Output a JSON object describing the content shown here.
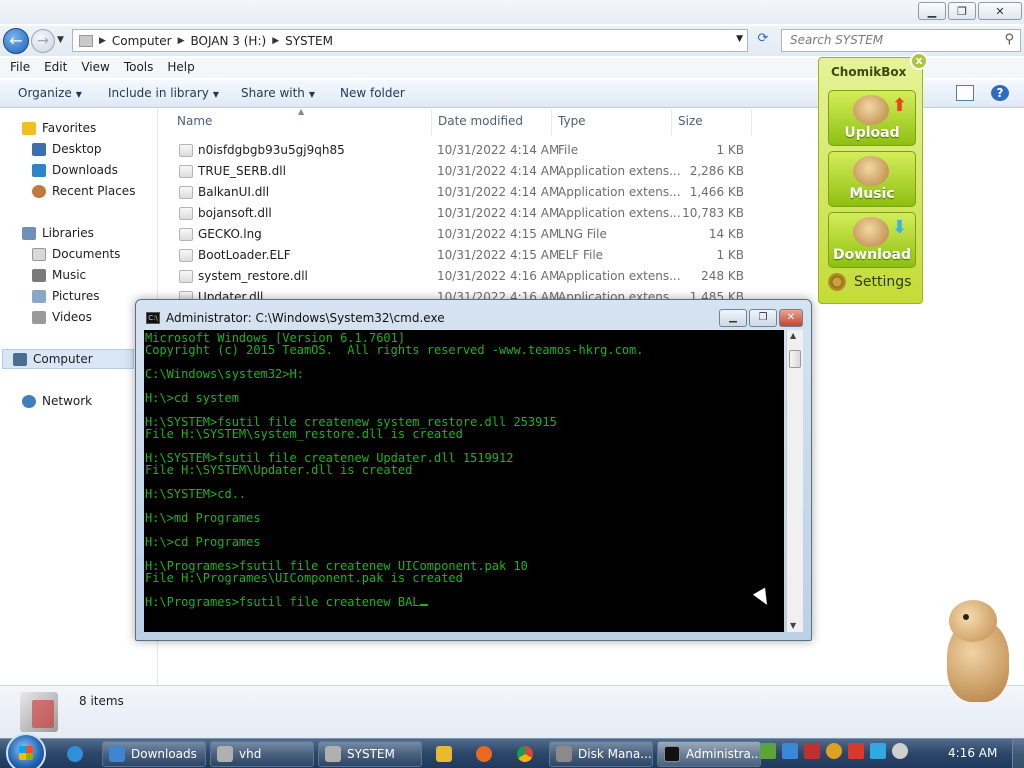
{
  "explorer": {
    "address": {
      "path": [
        "Computer",
        "BOJAN 3 (H:)",
        "SYSTEM"
      ]
    },
    "search_placeholder": "Search SYSTEM",
    "menu": [
      "File",
      "Edit",
      "View",
      "Tools",
      "Help"
    ],
    "commands": {
      "organize": "Organize",
      "include": "Include in library",
      "share": "Share with",
      "new_folder": "New folder"
    },
    "nav": {
      "favorites": "Favorites",
      "desktop": "Desktop",
      "downloads": "Downloads",
      "recent": "Recent Places",
      "libraries": "Libraries",
      "documents": "Documents",
      "music": "Music",
      "pictures": "Pictures",
      "videos": "Videos",
      "computer": "Computer",
      "network": "Network"
    },
    "columns": {
      "name": "Name",
      "date": "Date modified",
      "type": "Type",
      "size": "Size"
    },
    "files": [
      {
        "name": "n0isfdgbgb93u5gj9qh85",
        "date": "10/31/2022 4:14 AM",
        "type": "File",
        "size": "1 KB"
      },
      {
        "name": "TRUE_SERB.dll",
        "date": "10/31/2022 4:14 AM",
        "type": "Application extens...",
        "size": "2,286 KB"
      },
      {
        "name": "BalkanUI.dll",
        "date": "10/31/2022 4:14 AM",
        "type": "Application extens...",
        "size": "1,466 KB"
      },
      {
        "name": "bojansoft.dll",
        "date": "10/31/2022 4:14 AM",
        "type": "Application extens...",
        "size": "10,783 KB"
      },
      {
        "name": "GECKO.lng",
        "date": "10/31/2022 4:15 AM",
        "type": "LNG File",
        "size": "14 KB"
      },
      {
        "name": "BootLoader.ELF",
        "date": "10/31/2022 4:15 AM",
        "type": "ELF File",
        "size": "1 KB"
      },
      {
        "name": "system_restore.dll",
        "date": "10/31/2022 4:16 AM",
        "type": "Application extens...",
        "size": "248 KB"
      },
      {
        "name": "Updater.dll",
        "date": "10/31/2022 4:16 AM",
        "type": "Application extens...",
        "size": "1,485 KB"
      }
    ],
    "status": "8 items"
  },
  "chomikbox": {
    "title": "ChomikBox",
    "close": "x",
    "upload": "Upload",
    "music": "Music",
    "download": "Download",
    "settings": "Settings"
  },
  "cmd": {
    "title": "Administrator: C:\\Windows\\System32\\cmd.exe",
    "lines": [
      "Microsoft Windows [Version 6.1.7601]",
      "Copyright (c) 2015 TeamOS.  All rights reserved -www.teamos-hkrg.com.",
      "",
      "C:\\Windows\\system32>H:",
      "",
      "H:\\>cd system",
      "",
      "H:\\SYSTEM>fsutil file createnew system_restore.dll 253915",
      "File H:\\SYSTEM\\system_restore.dll is created",
      "",
      "H:\\SYSTEM>fsutil file createnew Updater.dll 1519912",
      "File H:\\SYSTEM\\Updater.dll is created",
      "",
      "H:\\SYSTEM>cd..",
      "",
      "H:\\>md Programes",
      "",
      "H:\\>cd Programes",
      "",
      "H:\\Programes>fsutil file createnew UIComponent.pak 10",
      "File H:\\Programes\\UIComponent.pak is created",
      "",
      "H:\\Programes>fsutil file createnew BAL"
    ]
  },
  "taskbar": {
    "buttons": [
      "Downloads",
      "vhd",
      "SYSTEM",
      "Disk Mana...",
      "Administra..."
    ],
    "clock": "4:16 AM"
  }
}
